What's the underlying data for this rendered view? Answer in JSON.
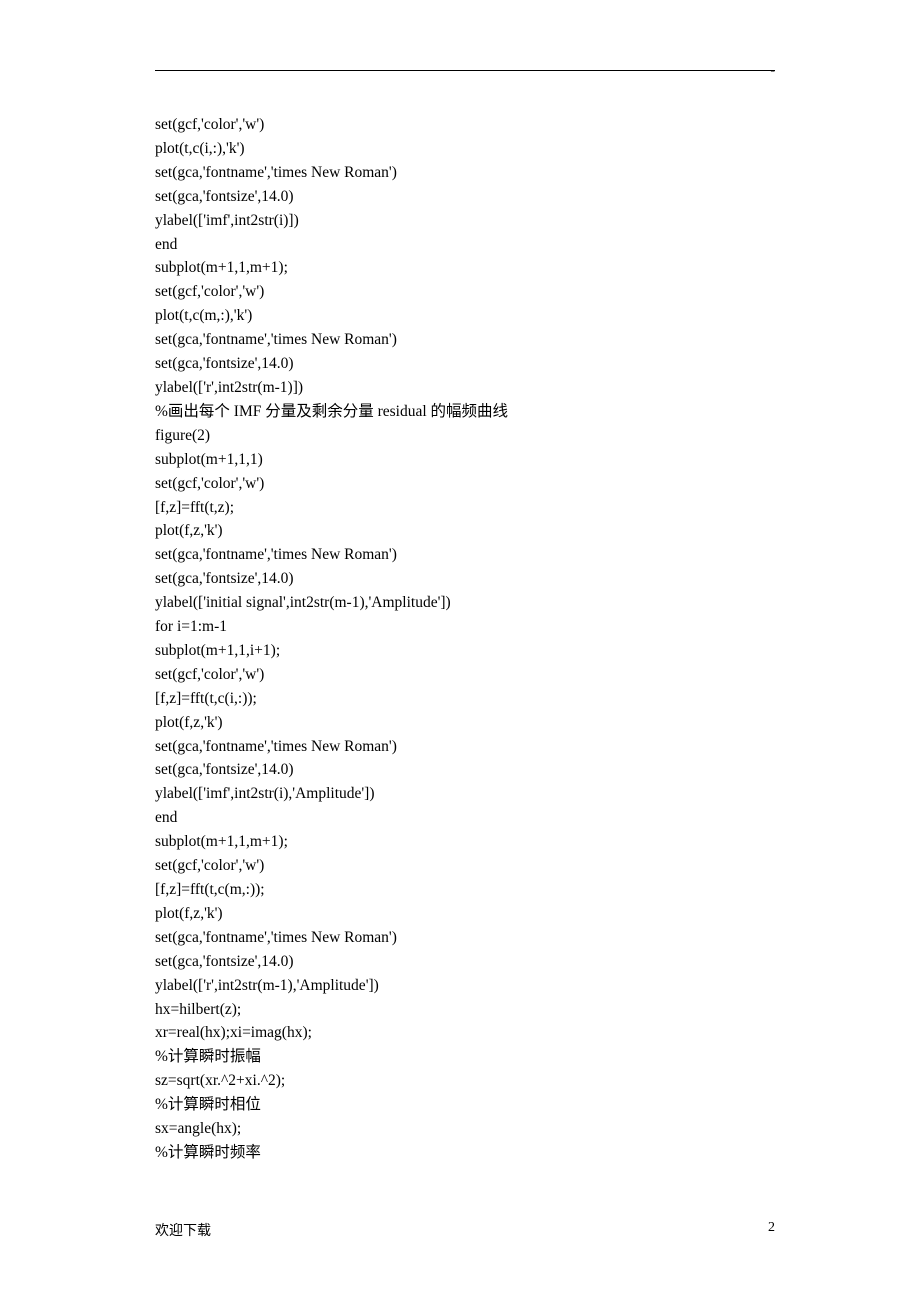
{
  "header": {
    "dash": "-"
  },
  "code": {
    "lines": [
      "set(gcf,'color','w')",
      "plot(t,c(i,:),'k')",
      "set(gca,'fontname','times New Roman')",
      "set(gca,'fontsize',14.0)",
      "ylabel(['imf',int2str(i)])",
      "end",
      "subplot(m+1,1,m+1);",
      "set(gcf,'color','w')",
      "plot(t,c(m,:),'k')",
      "set(gca,'fontname','times New Roman')",
      "set(gca,'fontsize',14.0)",
      "ylabel(['r',int2str(m-1)])",
      "%画出每个 IMF 分量及剩余分量 residual 的幅频曲线",
      "figure(2)",
      "subplot(m+1,1,1)",
      "set(gcf,'color','w')",
      "[f,z]=fft(t,z);",
      "plot(f,z,'k')",
      "set(gca,'fontname','times New Roman')",
      "set(gca,'fontsize',14.0)",
      "ylabel(['initial signal',int2str(m-1),'Amplitude'])",
      "for i=1:m-1",
      "subplot(m+1,1,i+1);",
      "set(gcf,'color','w')",
      "[f,z]=fft(t,c(i,:));",
      "plot(f,z,'k')",
      "set(gca,'fontname','times New Roman')",
      "set(gca,'fontsize',14.0)",
      "ylabel(['imf',int2str(i),'Amplitude'])",
      "end",
      "subplot(m+1,1,m+1);",
      "set(gcf,'color','w')",
      "[f,z]=fft(t,c(m,:));",
      "plot(f,z,'k')",
      "set(gca,'fontname','times New Roman')",
      "set(gca,'fontsize',14.0)",
      "ylabel(['r',int2str(m-1),'Amplitude'])",
      "hx=hilbert(z);",
      "xr=real(hx);xi=imag(hx);",
      "%计算瞬时振幅",
      "sz=sqrt(xr.^2+xi.^2);",
      "%计算瞬时相位",
      "sx=angle(hx);",
      "%计算瞬时频率"
    ]
  },
  "footer": {
    "left": "欢迎下载",
    "right": "2"
  }
}
